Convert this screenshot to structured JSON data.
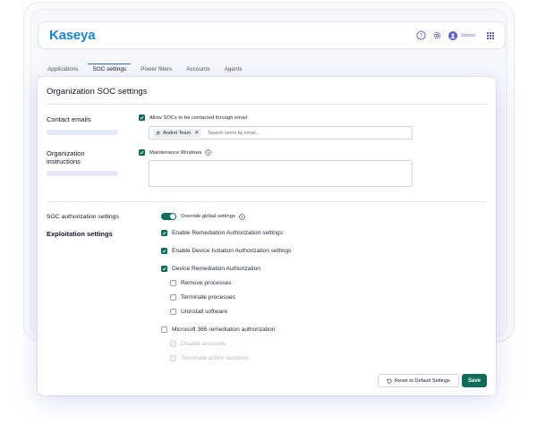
{
  "header": {
    "logo": "Kaseya",
    "username": "James",
    "icons": [
      "help-icon",
      "gear-icon",
      "user-icon",
      "apps-grid-icon"
    ]
  },
  "tabs": [
    {
      "label": "Applications",
      "active": false
    },
    {
      "label": "SOC settings",
      "active": true
    },
    {
      "label": "Power filters",
      "active": false
    },
    {
      "label": "Accounts",
      "active": false
    },
    {
      "label": "Agents",
      "active": false
    }
  ],
  "panel": {
    "title": "Organization SOC settings",
    "contact": {
      "label": "Contact emails",
      "allow_label": "Allow SOCs to be contacted through email",
      "allow_checked": true,
      "chip_label": "Andrei Team",
      "email_placeholder": "Search users by email..."
    },
    "instructions": {
      "label": "Organization instructions",
      "maintenance_label": "Maintenance Windows",
      "maintenance_checked": true
    },
    "soc_auth": {
      "label": "SOC authorization settings",
      "toggle_label": "Override global settings",
      "toggle_on": true
    },
    "exploitation": {
      "label": "Exploitation settings",
      "options": [
        {
          "label": "Enable Remediation Authorization settings",
          "checked": true
        },
        {
          "label": "Enable Device Isolation Authorization settings",
          "checked": true
        },
        {
          "label": "Device Remediation Authorization",
          "checked": true
        }
      ],
      "device_sub": [
        {
          "label": "Remove processes",
          "checked": false
        },
        {
          "label": "Terminate processes",
          "checked": false
        },
        {
          "label": "Uninstall software",
          "checked": false
        }
      ],
      "m365": {
        "label": "Microsoft 365 remediation authorization",
        "checked": false
      },
      "m365_sub": [
        {
          "label": "Disable accounts",
          "checked": false,
          "disabled": true
        },
        {
          "label": "Terminate active sessions",
          "checked": false,
          "disabled": true
        }
      ]
    },
    "buttons": {
      "reset": "Reset to Default Settings",
      "save": "Save"
    }
  },
  "colors": {
    "brand_blue": "#1a86d8",
    "accent_green": "#0f6b5a",
    "accent_purple": "#5b5bd6"
  }
}
